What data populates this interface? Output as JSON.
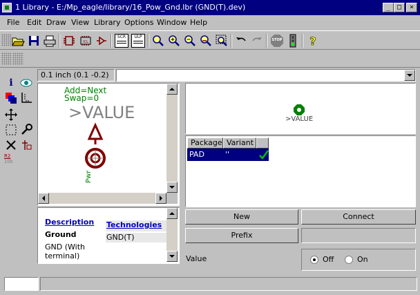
{
  "window": {
    "title": "1 Library - E:/Mp_eagle/library/16_Pow_Gnd.lbr (GND(T).dev)"
  },
  "window_buttons": {
    "minimize": "_",
    "maximize": "□",
    "close": "×"
  },
  "menu": [
    "File",
    "Edit",
    "Draw",
    "View",
    "Library",
    "Options",
    "Window",
    "Help"
  ],
  "toolbar": {
    "icons": [
      "open-icon",
      "save-icon",
      "print-icon",
      "symbol-icon",
      "package-icon",
      "device-icon",
      "script-icon",
      "ulp-icon",
      "zoom-fit-icon",
      "zoom-in-icon",
      "zoom-out-icon",
      "zoom-redraw-icon",
      "zoom-select-icon",
      "undo-icon",
      "redo-icon",
      "stop-icon",
      "go-icon",
      "help-icon"
    ],
    "stop_label": "STOP",
    "scr_label": "SCR",
    "ulp_label": "ULP"
  },
  "coords": {
    "text": "0.1 inch (0.1 -0.2)"
  },
  "symbol": {
    "add_text": "Add=Next",
    "swap_text": "Swap=0",
    "value_text": ">VALUE",
    "pin_name": "Pwr",
    "color_green": "#008000",
    "color_maroon": "#800000"
  },
  "description": {
    "tab_description": "Description",
    "tab_technologies": "Technologies",
    "name": "Ground",
    "detail": "GND (With terminal)",
    "technology": "GND(T)"
  },
  "package_preview": {
    "value_text": ">VALUE"
  },
  "package_table": {
    "headers": [
      "Package",
      "Variant"
    ],
    "rows": [
      {
        "package": "PAD",
        "variant": "''",
        "connected": true
      }
    ]
  },
  "buttons": {
    "new": "New",
    "connect": "Connect",
    "prefix": "Prefix",
    "prefix_value": ""
  },
  "value_option": {
    "label": "Value",
    "off": "Off",
    "on": "On",
    "selected": "Off"
  },
  "palette": {
    "info_label": "i",
    "r2_label": "R2",
    "value_label": "10k"
  }
}
